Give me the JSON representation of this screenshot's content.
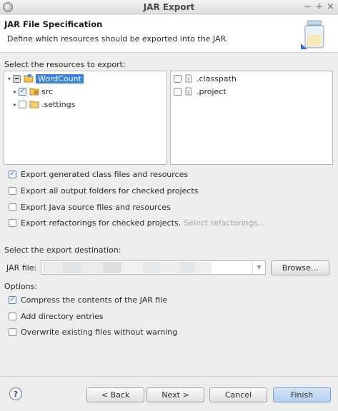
{
  "window": {
    "title": "JAR Export",
    "minimize": "−",
    "maximize": "+",
    "close": "×"
  },
  "header": {
    "title": "JAR File Specification",
    "description": "Define which resources should be exported into the JAR."
  },
  "resources": {
    "label": "Select the resources to export:",
    "tree": [
      {
        "label": "WordCount",
        "state": "partial",
        "expanded": true,
        "selected": true,
        "icon": "project-folder-icon"
      },
      {
        "label": "src",
        "state": "checked",
        "expanded": false,
        "icon": "package-folder-icon"
      },
      {
        "label": ".settings",
        "state": "unchecked",
        "expanded": false,
        "icon": "folder-icon"
      }
    ],
    "files": [
      {
        "label": ".classpath",
        "state": "unchecked",
        "icon": "file-icon"
      },
      {
        "label": ".project",
        "state": "unchecked",
        "icon": "file-icon"
      }
    ]
  },
  "export_options": [
    {
      "label": "Export generated class files and resources",
      "checked": true
    },
    {
      "label": "Export all output folders for checked projects",
      "checked": false
    },
    {
      "label": "Export Java source files and resources",
      "checked": false
    },
    {
      "label": "Export refactorings for checked projects.",
      "checked": false,
      "link": "Select refactorings..."
    }
  ],
  "destination": {
    "label": "Select the export destination:",
    "jar_file_label": "JAR file:",
    "browse_label": "Browse..."
  },
  "options": {
    "label": "Options:",
    "items": [
      {
        "label": "Compress the contents of the JAR file",
        "checked": true
      },
      {
        "label": "Add directory entries",
        "checked": false
      },
      {
        "label": "Overwrite existing files without warning",
        "checked": false
      }
    ]
  },
  "footer": {
    "help": "?",
    "back": "< Back",
    "next": "Next >",
    "cancel": "Cancel",
    "finish": "Finish"
  },
  "colors": {
    "selection": "#3a80d6",
    "check": "#2b5aa5",
    "primary_button": "#b6cff0"
  }
}
